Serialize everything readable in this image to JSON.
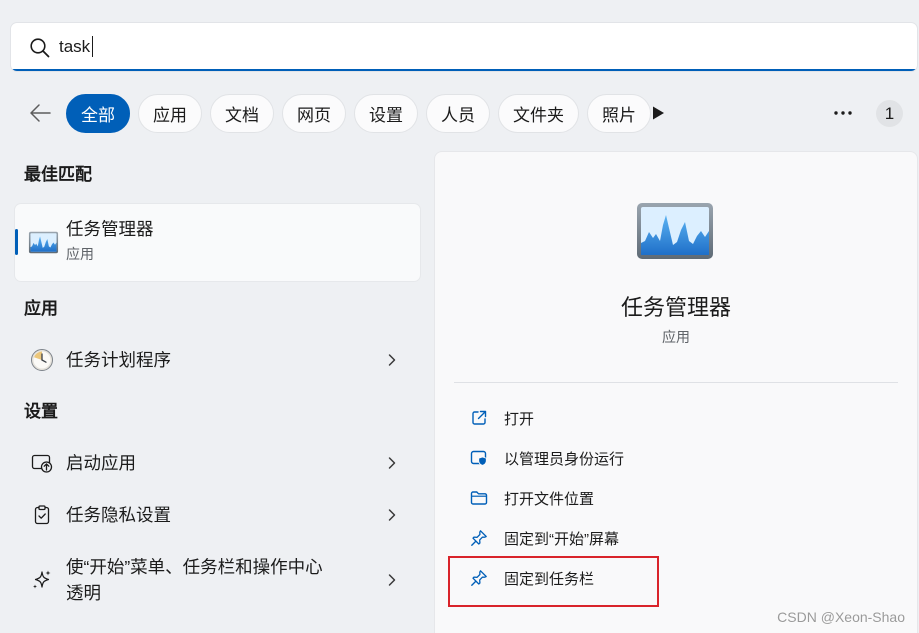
{
  "search": {
    "value": "task",
    "icon": "search-icon"
  },
  "filters": {
    "back_icon": "back-arrow-icon",
    "tabs": [
      {
        "label": "全部",
        "selected": true
      },
      {
        "label": "应用"
      },
      {
        "label": "文档"
      },
      {
        "label": "网页"
      },
      {
        "label": "设置"
      },
      {
        "label": "人员"
      },
      {
        "label": "文件夹"
      },
      {
        "label": "照片"
      }
    ],
    "scroll_icon": "play-icon",
    "more_icon": "more-icon",
    "badge": "1"
  },
  "results": {
    "best_match": {
      "heading": "最佳匹配",
      "title": "任务管理器",
      "subtitle": "应用",
      "icon": "task-manager-icon"
    },
    "apps": {
      "heading": "应用",
      "items": [
        {
          "label": "任务计划程序",
          "icon": "task-scheduler-icon"
        }
      ]
    },
    "settings": {
      "heading": "设置",
      "items": [
        {
          "label": "启动应用",
          "icon": "startup-apps-icon"
        },
        {
          "label": "任务隐私设置",
          "icon": "clipboard-check-icon"
        },
        {
          "lines": [
            "使“开始”菜单、任务栏和操作中心",
            "透明"
          ],
          "icon": "sparkle-icon"
        }
      ]
    },
    "row_chevron_icon": "chevron-right-icon"
  },
  "detail": {
    "icon": "task-manager-icon",
    "title": "任务管理器",
    "subtitle": "应用",
    "actions": [
      {
        "label": "打开",
        "icon": "open-external-icon"
      },
      {
        "label": "以管理员身份运行",
        "icon": "admin-shield-icon"
      },
      {
        "label": "打开文件位置",
        "icon": "folder-icon"
      },
      {
        "label": "固定到“开始”屏幕",
        "icon": "pin-icon"
      },
      {
        "label": "固定到任务栏",
        "icon": "pin-icon"
      }
    ]
  },
  "watermark": "CSDN @Xeon-Shao",
  "colors": {
    "accent": "#005fb8",
    "highlight_box": "#d9232a",
    "background": "#eef0f3"
  }
}
